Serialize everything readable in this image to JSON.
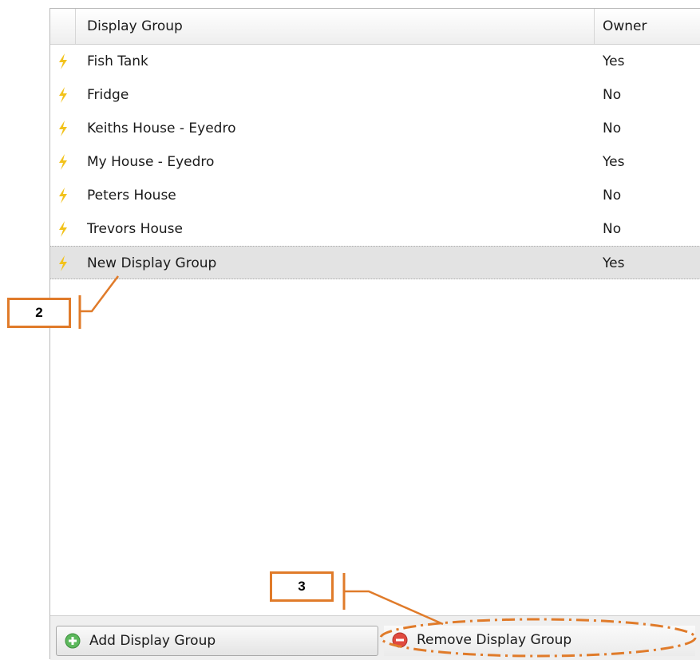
{
  "table": {
    "columns": {
      "name": "Display Group",
      "owner": "Owner"
    },
    "rows": [
      {
        "name": "Fish Tank",
        "owner": "Yes"
      },
      {
        "name": "Fridge",
        "owner": "No"
      },
      {
        "name": "Keiths House - Eyedro",
        "owner": "No"
      },
      {
        "name": "My House - Eyedro",
        "owner": "Yes"
      },
      {
        "name": "Peters House",
        "owner": "No"
      },
      {
        "name": "Trevors House",
        "owner": "No"
      },
      {
        "name": "New Display Group",
        "owner": "Yes",
        "selected": true
      }
    ],
    "row_icon": "lightning-bolt-icon"
  },
  "toolbar": {
    "add_label": "Add Display Group",
    "add_icon": "add-circle-icon",
    "remove_label": "Remove Display Group",
    "remove_icon": "remove-circle-icon"
  },
  "callouts": [
    {
      "label": "2",
      "target": "New Display Group"
    },
    {
      "label": "3",
      "target": "Remove Display Group"
    }
  ],
  "colors": {
    "callout": "#e07b2a",
    "selected_row": "#e3e3e3",
    "bolt": "#f2c21b",
    "add_icon": "#5cb85c",
    "remove_icon": "#e04a3f"
  }
}
